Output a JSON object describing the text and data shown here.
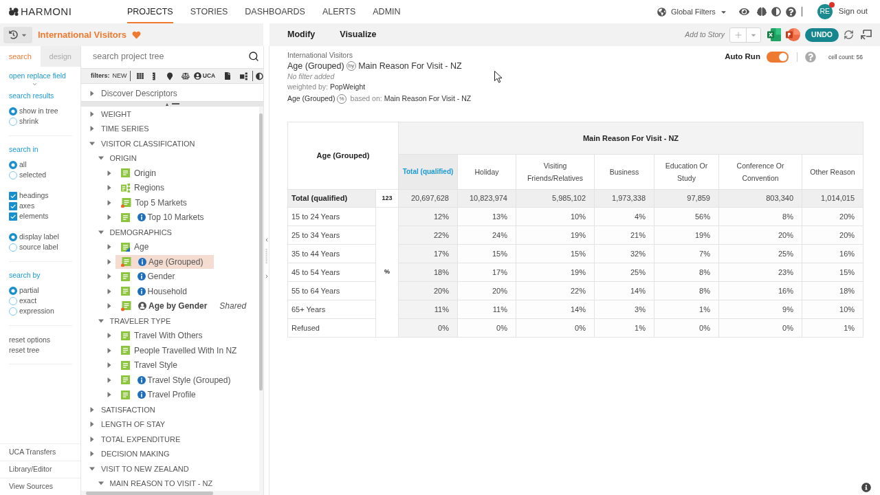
{
  "header": {
    "logo": "HARMONI",
    "nav": [
      {
        "label": "PROJECTS",
        "selected": true
      },
      {
        "label": "STORIES",
        "selected": false
      },
      {
        "label": "DASHBOARDS",
        "selected": false
      },
      {
        "label": "ALERTS",
        "selected": false
      },
      {
        "label": "ADMIN",
        "selected": false
      }
    ],
    "global_filters": "Global Filters",
    "avatar": {
      "initials": "RE",
      "notification": true
    },
    "sign_out": "Sign out"
  },
  "project_bar": {
    "title": "International Visitors",
    "favorite": true
  },
  "toolbar": {
    "actions": [
      "Modify",
      "Visualize"
    ],
    "add_to_story": "Add to Story",
    "undo": "UNDO"
  },
  "options_panel": {
    "tabs": [
      {
        "label": "search",
        "selected": true
      },
      {
        "label": "design",
        "selected": false
      }
    ],
    "replace_link": "open replace field",
    "sections": [
      {
        "title": "search results",
        "sets": [
          [
            {
              "kind": "radio",
              "label": "show in tree",
              "selected": true
            },
            {
              "kind": "radio",
              "label": "shrink",
              "selected": false
            }
          ]
        ]
      },
      {
        "title": "search in",
        "sets": [
          [
            {
              "kind": "radio",
              "label": "all",
              "selected": true
            },
            {
              "kind": "radio",
              "label": "selected",
              "selected": false
            }
          ],
          [
            {
              "kind": "checkbox",
              "label": "headings",
              "checked": true
            },
            {
              "kind": "checkbox",
              "label": "axes",
              "checked": true
            },
            {
              "kind": "checkbox",
              "label": "elements",
              "checked": true
            }
          ],
          [
            {
              "kind": "radio",
              "label": "display label",
              "selected": true
            },
            {
              "kind": "radio",
              "label": "source label",
              "selected": false
            }
          ]
        ]
      },
      {
        "title": "search by",
        "sets": [
          [
            {
              "kind": "radio",
              "label": "partial",
              "selected": true
            },
            {
              "kind": "radio",
              "label": "exact",
              "selected": false
            },
            {
              "kind": "radio",
              "label": "expression",
              "selected": false
            }
          ]
        ]
      }
    ],
    "reset_links": [
      "reset options",
      "reset tree"
    ],
    "footer_links": [
      "UCA Transfers",
      "Library/Editor",
      "View Sources"
    ]
  },
  "tree_panel": {
    "search_placeholder": "search project tree",
    "filters_label": "filters:",
    "new_filter": "NEW",
    "uca_filter": "UCA",
    "discover": "Discover Descriptors",
    "nodes": [
      {
        "label": "WEIGHT",
        "kind": "folder",
        "expanded": false,
        "selected": false
      },
      {
        "label": "TIME SERIES",
        "kind": "folder",
        "expanded": false,
        "selected": false
      },
      {
        "label": "VISITOR CLASSIFICATION",
        "kind": "folder",
        "expanded": true,
        "selected": false,
        "children": [
          {
            "label": "ORIGIN",
            "kind": "folder",
            "expanded": true,
            "selected": false,
            "children": [
              {
                "label": "Origin",
                "kind": "variable",
                "info": false,
                "shared": false,
                "expanded": false,
                "selected": false
              },
              {
                "label": "Regions",
                "kind": "hierarchy",
                "info": false,
                "shared": false,
                "expanded": false,
                "selected": false
              },
              {
                "label": "Top 5 Markets",
                "kind": "dotted",
                "info": false,
                "shared": false,
                "expanded": false,
                "selected": false
              },
              {
                "label": "Top 10 Markets",
                "kind": "variable",
                "info": true,
                "shared": false,
                "expanded": false,
                "selected": false
              }
            ]
          },
          {
            "label": "DEMOGRAPHICS",
            "kind": "folder",
            "expanded": true,
            "selected": false,
            "children": [
              {
                "label": "Age",
                "kind": "cornered",
                "info": false,
                "shared": false,
                "expanded": false,
                "selected": false
              },
              {
                "label": "Age (Grouped)",
                "kind": "dotted",
                "info": true,
                "shared": false,
                "expanded": false,
                "selected": true
              },
              {
                "label": "Gender",
                "kind": "variable",
                "info": true,
                "shared": false,
                "expanded": false,
                "selected": false
              },
              {
                "label": "Household",
                "kind": "variable",
                "info": true,
                "shared": false,
                "expanded": false,
                "selected": false
              },
              {
                "label": "Age by Gender",
                "kind": "dotted",
                "info": false,
                "shared": true,
                "note": "Shared",
                "expanded": false,
                "selected": false
              }
            ]
          },
          {
            "label": "TRAVELER TYPE",
            "kind": "folder",
            "expanded": true,
            "selected": false,
            "children": [
              {
                "label": "Travel With Others",
                "kind": "variable",
                "info": false,
                "shared": false,
                "expanded": false,
                "selected": false
              },
              {
                "label": "People Travelled With In NZ",
                "kind": "variable",
                "info": false,
                "shared": false,
                "expanded": false,
                "selected": false
              },
              {
                "label": "Travel Style",
                "kind": "variable",
                "info": false,
                "shared": false,
                "expanded": false,
                "selected": false
              },
              {
                "label": "Travel Style (Grouped)",
                "kind": "variable",
                "info": true,
                "shared": false,
                "expanded": false,
                "selected": false
              },
              {
                "label": "Travel Profile",
                "kind": "variable",
                "info": true,
                "shared": false,
                "expanded": false,
                "selected": false
              }
            ]
          }
        ]
      },
      {
        "label": "SATISFACTION",
        "kind": "folder",
        "expanded": false,
        "selected": false
      },
      {
        "label": "LENGTH OF STAY",
        "kind": "folder",
        "expanded": false,
        "selected": false
      },
      {
        "label": "TOTAL EXPENDITURE",
        "kind": "folder",
        "expanded": false,
        "selected": false
      },
      {
        "label": "DECISION MAKING",
        "kind": "folder",
        "expanded": false,
        "selected": false
      },
      {
        "label": "VISIT TO NEW ZEALAND",
        "kind": "folder",
        "expanded": true,
        "selected": false,
        "children": [
          {
            "label": "MAIN REASON TO VISIT - NZ",
            "kind": "folder",
            "expanded": true,
            "selected": false
          }
        ]
      }
    ]
  },
  "analysis": {
    "project": "International Visitors",
    "row_variable": "Age (Grouped)",
    "by_symbol": "by",
    "column_variable": "Main Reason For Visit - NZ",
    "filter_note": "No filter added",
    "weighted_label": "weighted by:",
    "weight": "PopWeight",
    "base_row": "Age (Grouped)",
    "percent_symbol": "%",
    "based_on_label": "based on:",
    "base_column": "Main Reason For Visit - NZ",
    "auto_run": {
      "label": "Auto Run",
      "on": true
    },
    "cell_count": "cell count: 56"
  },
  "table": {
    "corner": "Age (Grouped)",
    "banner": "Main Reason For Visit - NZ",
    "columns": [
      {
        "label": "Total (qualified)",
        "kind": "total"
      },
      {
        "label": "Holiday",
        "kind": "category"
      },
      {
        "label": "Visiting Friends/Relatives",
        "kind": "category"
      },
      {
        "label": "Business",
        "kind": "category"
      },
      {
        "label": "Education Or Study",
        "kind": "category"
      },
      {
        "label": "Conference Or Convention",
        "kind": "category"
      },
      {
        "label": "Other Reason",
        "kind": "category"
      }
    ],
    "total_row": {
      "label": "Total (qualified)",
      "stat": "123",
      "values": [
        "20,697,628",
        "10,823,974",
        "5,985,102",
        "1,973,338",
        "97,859",
        "803,340",
        "1,014,015"
      ]
    },
    "stat_label": "%",
    "rows": [
      {
        "label": "15 to 24 Years",
        "values": [
          "12%",
          "13%",
          "10%",
          "4%",
          "56%",
          "8%",
          "20%"
        ]
      },
      {
        "label": "25 to 34 Years",
        "values": [
          "22%",
          "24%",
          "19%",
          "21%",
          "19%",
          "20%",
          "20%"
        ]
      },
      {
        "label": "35 to 44 Years",
        "values": [
          "17%",
          "15%",
          "15%",
          "32%",
          "7%",
          "25%",
          "16%"
        ]
      },
      {
        "label": "45 to 54 Years",
        "values": [
          "18%",
          "17%",
          "19%",
          "25%",
          "8%",
          "23%",
          "15%"
        ]
      },
      {
        "label": "55 to 64 Years",
        "values": [
          "20%",
          "20%",
          "22%",
          "14%",
          "8%",
          "16%",
          "18%"
        ]
      },
      {
        "label": "65+ Years",
        "values": [
          "11%",
          "11%",
          "14%",
          "3%",
          "1%",
          "9%",
          "10%"
        ]
      },
      {
        "label": "Refused",
        "values": [
          "0%",
          "0%",
          "0%",
          "1%",
          "0%",
          "0%",
          "1%"
        ]
      }
    ]
  }
}
